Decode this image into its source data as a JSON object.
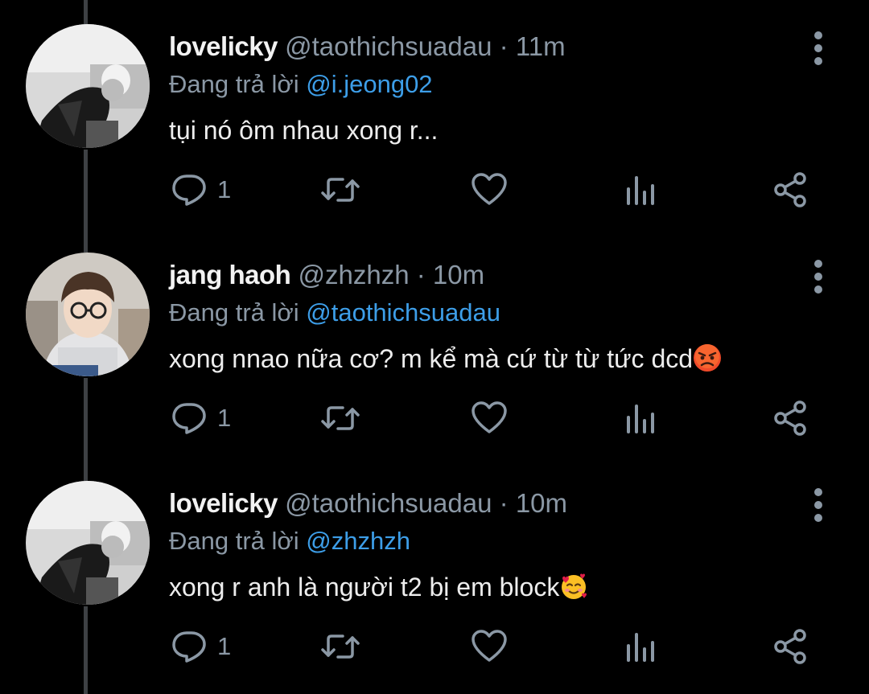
{
  "reply_prefix": "Đang trả lời",
  "colors": {
    "background": "#000000",
    "mention": "#3d9ee8",
    "muted": "#8b98a5",
    "text": "#e7e9ea"
  },
  "tweets": [
    {
      "display_name": "lovelicky",
      "handle": "@taothichsuadau",
      "separator": "·",
      "time": "11m",
      "reply_to": "@i.jeong02",
      "text": "tụi nó ôm nhau xong r...",
      "emoji": "",
      "reply_count": "1",
      "avatar": "grayscale-photo"
    },
    {
      "display_name": "jang haoh",
      "handle": "@zhzhzh",
      "separator": "·",
      "time": "10m",
      "reply_to": "@taothichsuadau",
      "text": "xong nnao nữa cơ? m kể mà cứ từ từ tức dcd",
      "emoji": "angry-face",
      "reply_count": "1",
      "avatar": "color-photo"
    },
    {
      "display_name": "lovelicky",
      "handle": "@taothichsuadau",
      "separator": "·",
      "time": "10m",
      "reply_to": "@zhzhzh",
      "text": "xong r anh là người t2 bị em block",
      "emoji": "smiling-face-with-hearts",
      "reply_count": "1",
      "avatar": "grayscale-photo"
    }
  ],
  "icons": [
    "reply-icon",
    "retweet-icon",
    "like-icon",
    "views-icon",
    "share-icon",
    "more-icon"
  ]
}
